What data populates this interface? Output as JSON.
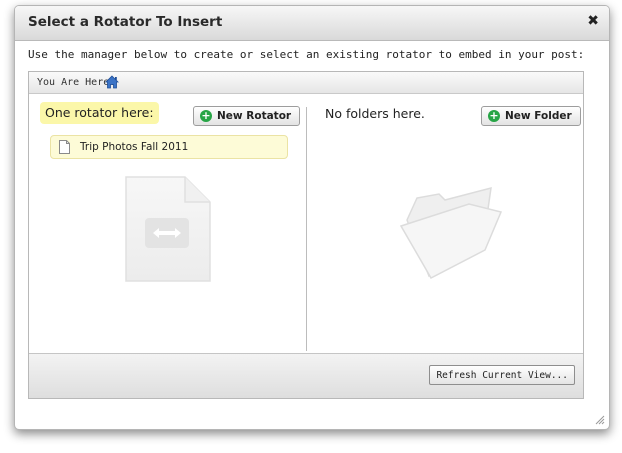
{
  "dialog": {
    "title": "Select a Rotator To Insert",
    "close_icon": "close-icon",
    "close_glyph": "✖",
    "instructions": "Use the manager below to create or select an existing rotator to embed in your post:"
  },
  "breadcrumb": {
    "label": "You Are Here:",
    "home_icon": "home-icon"
  },
  "rotators_pane": {
    "heading": "One rotator here:",
    "new_button_label": "New Rotator",
    "items": [
      {
        "name": "Trip Photos Fall 2011",
        "icon": "document-icon"
      }
    ]
  },
  "folders_pane": {
    "heading": "No folders here.",
    "new_button_label": "New Folder"
  },
  "footer": {
    "refresh_label": "Refresh Current View..."
  },
  "colors": {
    "highlight": "#fbf7a9",
    "item_background": "#fdfbd7",
    "add_icon_green": "#27a546",
    "home_icon_blue": "#3b73c6"
  }
}
